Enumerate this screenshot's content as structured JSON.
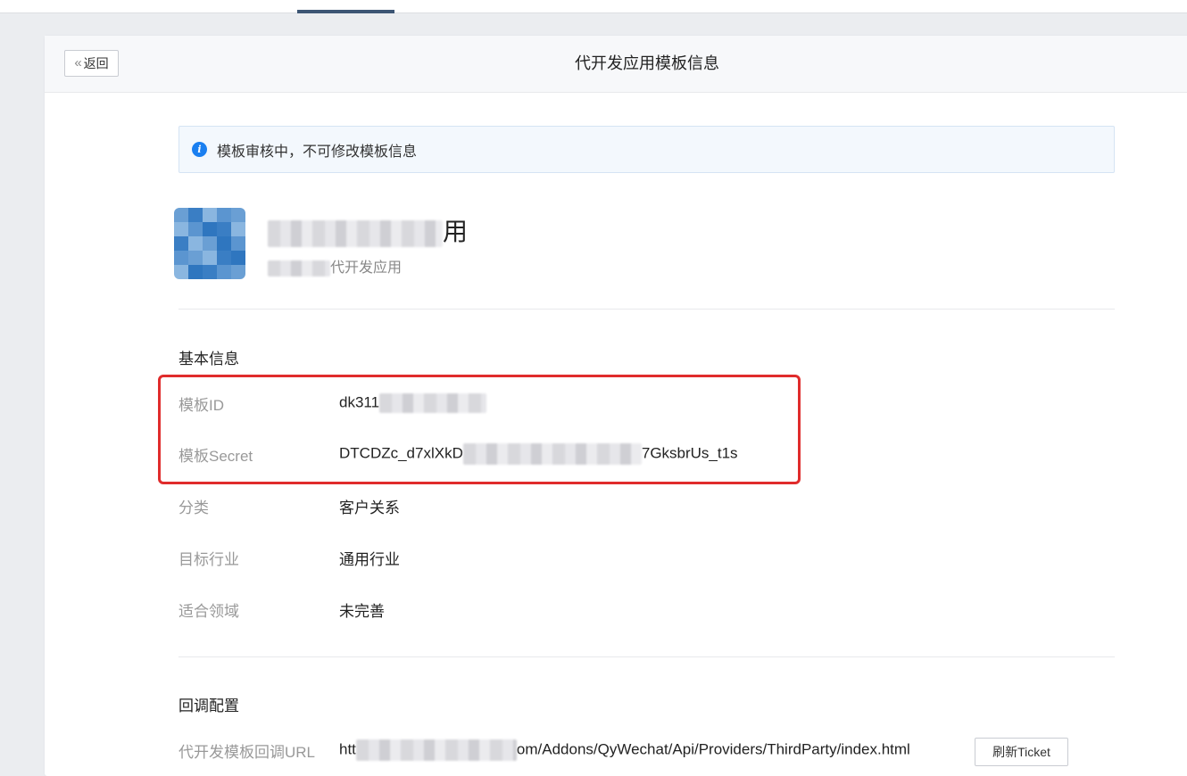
{
  "header": {
    "back_label": "返回",
    "title": "代开发应用模板信息"
  },
  "notice": {
    "icon": "info-icon",
    "text": "模板审核中，不可修改模板信息"
  },
  "app": {
    "name_visible": "用",
    "subtitle_visible": "代开发应用",
    "icon_colors": [
      "#6a9fd4",
      "#3a7ec4",
      "#8ab6e0",
      "#5b95d0",
      "#2f76bf"
    ]
  },
  "basic_info": {
    "title": "基本信息",
    "fields": [
      {
        "label": "模板ID",
        "value": "dk311",
        "value_suffix": ""
      },
      {
        "label": "模板Secret",
        "value": "DTCDZc_d7xlXkD",
        "value_suffix": "7GksbrUs_t1s"
      },
      {
        "label": "分类",
        "value": "客户关系",
        "value_suffix": ""
      },
      {
        "label": "目标行业",
        "value": "通用行业",
        "value_suffix": ""
      },
      {
        "label": "适合领域",
        "value": "未完善",
        "value_suffix": ""
      }
    ]
  },
  "callback": {
    "title": "回调配置",
    "url_label": "代开发模板回调URL",
    "url_prefix": "htt",
    "url_suffix": "om/Addons/QyWechat/Api/Providers/ThirdParty/index.html",
    "refresh_label": "刷新Ticket"
  },
  "colors": {
    "highlight": "#e02c2c",
    "info": "#1a7ff0",
    "active_tab": "#3d5674"
  }
}
